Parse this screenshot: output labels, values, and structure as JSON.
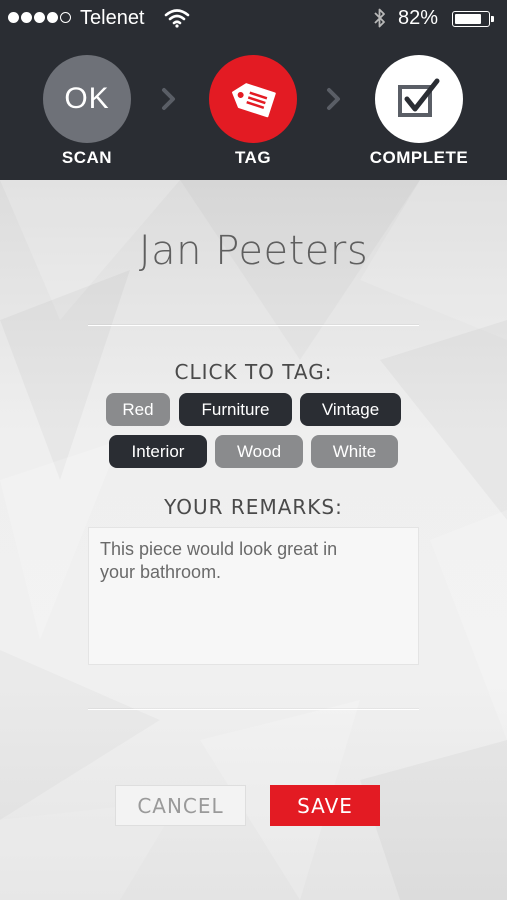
{
  "status_bar": {
    "signal_dots": [
      true,
      true,
      true,
      true,
      false
    ],
    "carrier": "Telenet",
    "battery_percent_text": "82%",
    "battery_level": 0.82,
    "wifi_icon": "wifi-icon",
    "bluetooth_icon": "bluetooth-icon"
  },
  "steps": [
    {
      "label": "SCAN",
      "circle_text": "OK",
      "color": "#6e7178",
      "icon": "ok-text"
    },
    {
      "label": "TAG",
      "color": "#e31b23",
      "icon": "tag-icon"
    },
    {
      "label": "COMPLETE",
      "color": "#ffffff",
      "icon": "checkbox-check-icon"
    }
  ],
  "person_name": "Jan Peeters",
  "tags_section": {
    "heading": "CLICK TO TAG:",
    "tags": [
      {
        "label": "Red",
        "selected": false
      },
      {
        "label": "Furniture",
        "selected": true
      },
      {
        "label": "Vintage",
        "selected": true
      },
      {
        "label": "Interior",
        "selected": true
      },
      {
        "label": "Wood",
        "selected": false
      },
      {
        "label": "White",
        "selected": false
      }
    ]
  },
  "remarks_section": {
    "heading": "YOUR REMARKS:",
    "value": "This piece would look great in\nyour bathroom."
  },
  "buttons": {
    "cancel": "CANCEL",
    "save": "SAVE"
  },
  "colors": {
    "header_bg": "#2a2d33",
    "accent_red": "#e31b23",
    "tag_selected": "#2a2d33",
    "tag_unselected": "#8a8b8d"
  }
}
